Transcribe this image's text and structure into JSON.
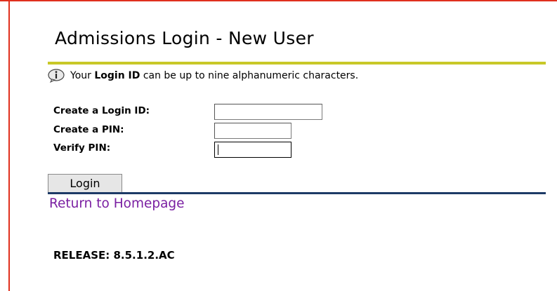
{
  "page": {
    "title": "Admissions Login - New User"
  },
  "info": {
    "icon": "info-icon",
    "prefix": "Your ",
    "emphasis": "Login ID",
    "suffix": " can be up to nine alphanumeric characters."
  },
  "form": {
    "login_id_label": "Create a Login ID:",
    "login_id_value": "",
    "pin_label": "Create a PIN:",
    "pin_value": "",
    "verify_label": "Verify PIN:",
    "verify_value": ""
  },
  "actions": {
    "login_label": "Login",
    "home_link": "Return to Homepage"
  },
  "footer": {
    "release": "RELEASE: 8.5.1.2.AC"
  },
  "colors": {
    "title_rule": "#c8c828",
    "bottom_rule": "#1d3a66",
    "link": "#7a1fa2",
    "frame": "#e0301e"
  }
}
